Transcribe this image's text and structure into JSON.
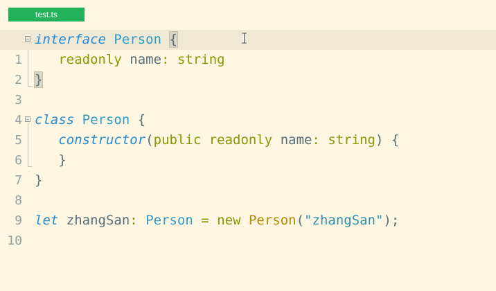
{
  "tab": {
    "label": "test.ts"
  },
  "gutter": {
    "line_numbers": [
      "1",
      "2",
      "3",
      "4",
      "5",
      "6",
      "7",
      "8",
      "9",
      "10"
    ]
  },
  "code": {
    "l1": {
      "interface": "interface",
      "name": "Person",
      "brace": "{"
    },
    "l2": {
      "readonly": "readonly",
      "prop": "name",
      "colon": ":",
      "type": "string"
    },
    "l3": {
      "brace": "}"
    },
    "l5": {
      "class": "class",
      "name": "Person",
      "brace": "{"
    },
    "l6": {
      "ctor": "constructor",
      "paren_open": "(",
      "public": "public",
      "readonly": "readonly",
      "prop": "name",
      "colon": ":",
      "type": "string",
      "paren_close": ")",
      "brace": "{"
    },
    "l7": {
      "brace": "}"
    },
    "l8": {
      "brace": "}"
    },
    "l10": {
      "let": "let",
      "var": "zhangSan",
      "colon": ":",
      "type": "Person",
      "eq": "=",
      "new": "new",
      "ctor": "Person",
      "paren_open": "(",
      "str": "\"zhangSan\"",
      "paren_close": ");"
    }
  },
  "icons": {
    "cursor": "text-cursor-icon",
    "fold": "fold-toggle-icon"
  },
  "colors": {
    "background": "#fdf6e3",
    "tab": "#22b15a",
    "current_line": "#eee8d5"
  }
}
